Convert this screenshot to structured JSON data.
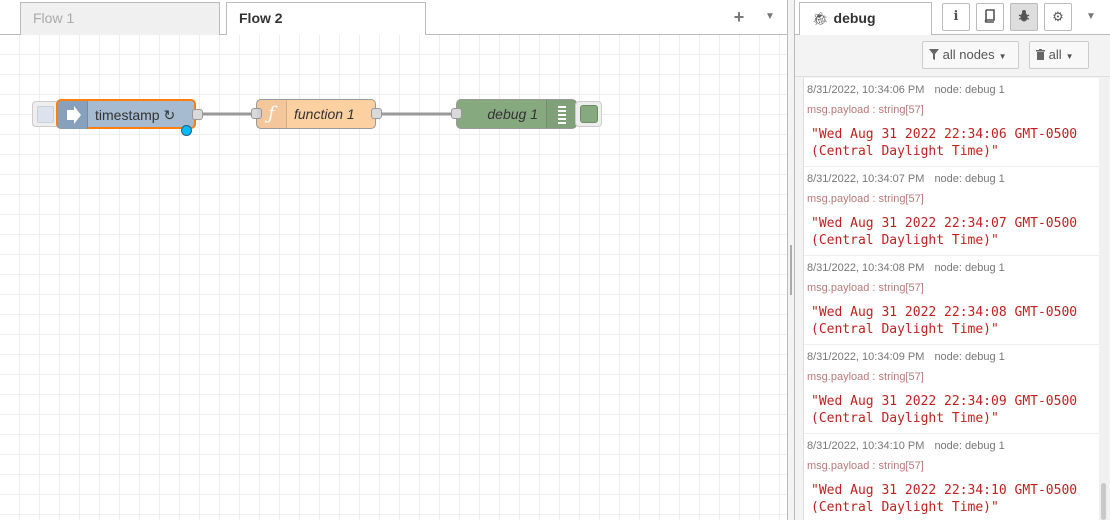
{
  "workspace": {
    "tabs": [
      {
        "label": "Flow 1",
        "active": false
      },
      {
        "label": "Flow 2",
        "active": true
      }
    ],
    "add_flow_icon": "plus-icon",
    "flow_menu_icon": "caret-down-icon"
  },
  "flow": {
    "nodes": [
      {
        "id": "timestamp",
        "label": "timestamp ↻",
        "type": "inject",
        "color": "#a6bbcf",
        "icon": "arrow-in-icon",
        "changed": true
      },
      {
        "id": "function",
        "label": "function 1",
        "type": "function",
        "color": "#fdd0a2",
        "icon": "function-icon"
      },
      {
        "id": "debug",
        "label": "debug 1",
        "type": "debug",
        "color": "#87a980",
        "icon": "list-icon"
      }
    ],
    "selection_color": "#ff7f0e",
    "changed_dot_color": "#00bcff"
  },
  "sidebar": {
    "active_tab": "debug",
    "tab_label": "debug",
    "tab_icons": [
      "info-icon",
      "book-icon",
      "bug-icon",
      "gear-icon"
    ],
    "filter_label": "all nodes",
    "clear_label": "all",
    "messages": [
      {
        "time": "8/31/2022, 10:34:06 PM",
        "node": "node: debug 1",
        "topic": "msg.payload : string[57]",
        "payload": "\"Wed Aug 31 2022 22:34:06 GMT-0500\n(Central Daylight Time)\""
      },
      {
        "time": "8/31/2022, 10:34:07 PM",
        "node": "node: debug 1",
        "topic": "msg.payload : string[57]",
        "payload": "\"Wed Aug 31 2022 22:34:07 GMT-0500\n(Central Daylight Time)\""
      },
      {
        "time": "8/31/2022, 10:34:08 PM",
        "node": "node: debug 1",
        "topic": "msg.payload : string[57]",
        "payload": "\"Wed Aug 31 2022 22:34:08 GMT-0500\n(Central Daylight Time)\""
      },
      {
        "time": "8/31/2022, 10:34:09 PM",
        "node": "node: debug 1",
        "topic": "msg.payload : string[57]",
        "payload": "\"Wed Aug 31 2022 22:34:09 GMT-0500\n(Central Daylight Time)\""
      },
      {
        "time": "8/31/2022, 10:34:10 PM",
        "node": "node: debug 1",
        "topic": "msg.payload : string[57]",
        "payload": "\"Wed Aug 31 2022 22:34:10 GMT-0500\n(Central Daylight Time)\""
      }
    ]
  }
}
